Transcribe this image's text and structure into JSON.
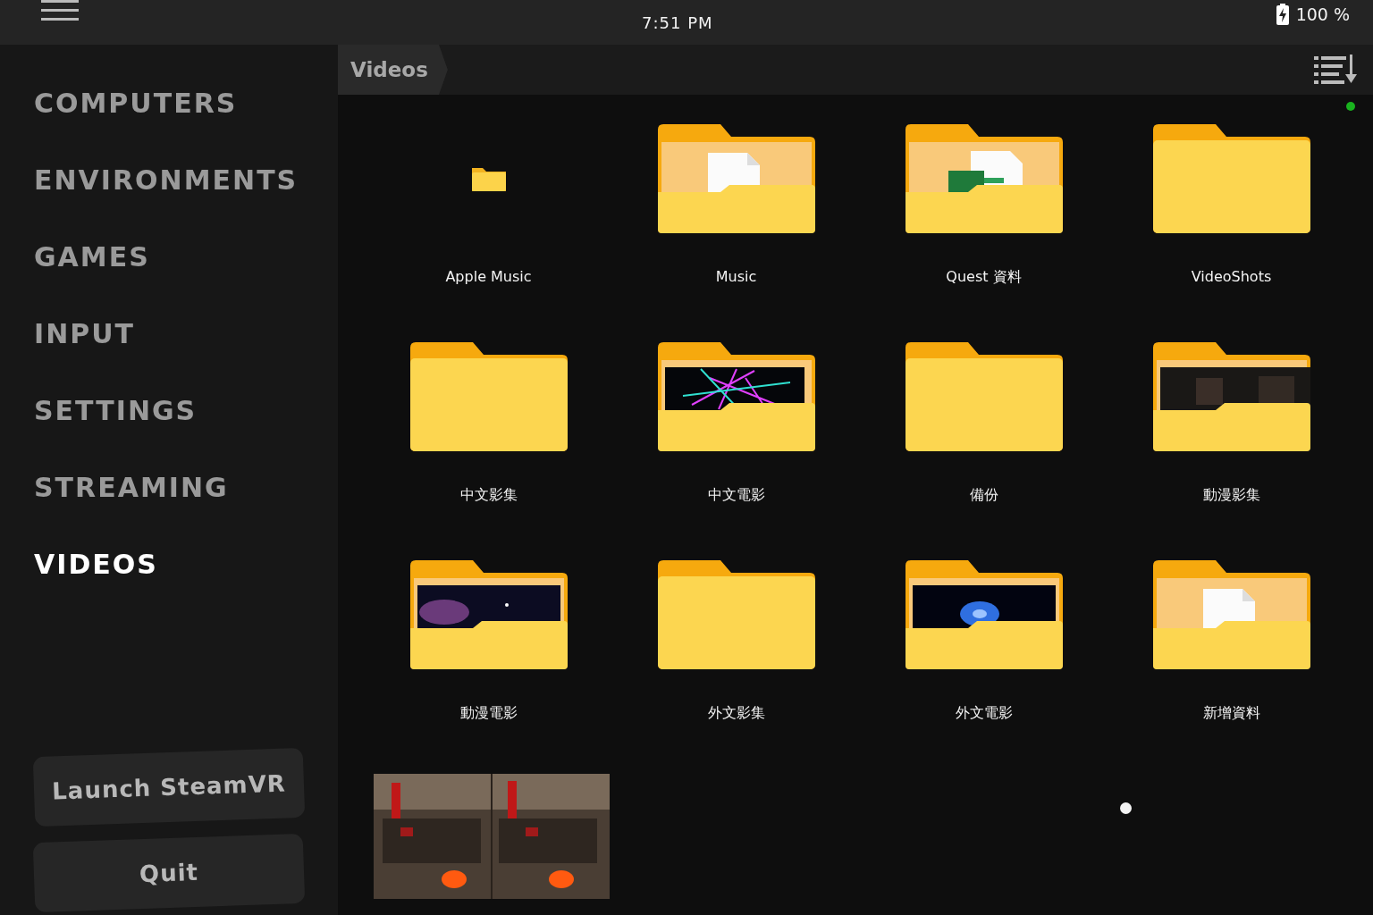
{
  "status_bar": {
    "time": "7:51 PM",
    "battery": "100 %"
  },
  "sidebar": {
    "items": [
      {
        "label": "COMPUTERS",
        "selected": false
      },
      {
        "label": "ENVIRONMENTS",
        "selected": false
      },
      {
        "label": "GAMES",
        "selected": false
      },
      {
        "label": "INPUT",
        "selected": false
      },
      {
        "label": "SETTINGS",
        "selected": false
      },
      {
        "label": "STREAMING",
        "selected": false
      },
      {
        "label": "VIDEOS",
        "selected": true
      }
    ],
    "buttons": [
      "Launch SteamVR",
      "Quit"
    ]
  },
  "breadcrumb": [
    "Videos"
  ],
  "items": [
    {
      "name": "Apple Music",
      "kind": "small"
    },
    {
      "name": "Music",
      "kind": "document"
    },
    {
      "name": "Quest 資料",
      "kind": "spreadsheet"
    },
    {
      "name": "VideoShots",
      "kind": "empty"
    },
    {
      "name": "中文影集",
      "kind": "empty"
    },
    {
      "name": "中文電影",
      "kind": "lights"
    },
    {
      "name": "備份",
      "kind": "empty"
    },
    {
      "name": "動漫影集",
      "kind": "room"
    },
    {
      "name": "動漫電影",
      "kind": "space"
    },
    {
      "name": "外文影集",
      "kind": "empty"
    },
    {
      "name": "外文電影",
      "kind": "nebula"
    },
    {
      "name": "新增資料",
      "kind": "document"
    },
    {
      "kind": "picture"
    }
  ]
}
